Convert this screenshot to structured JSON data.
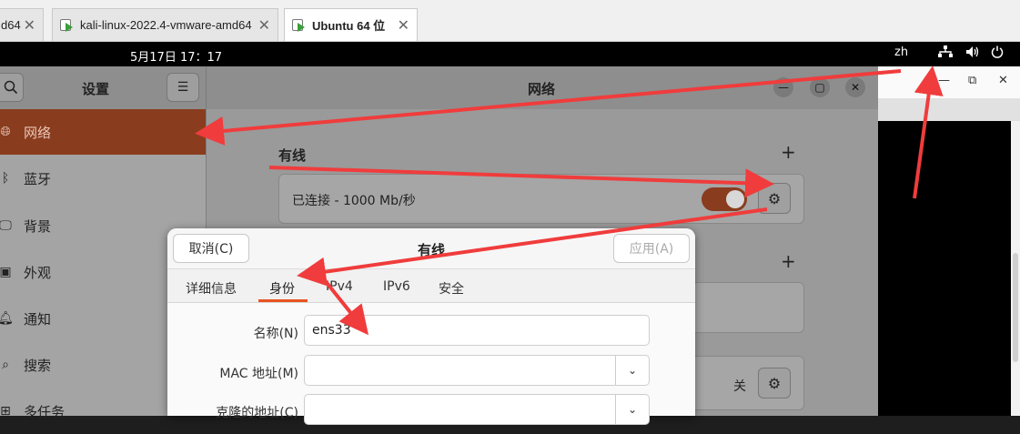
{
  "vmware_tabs": [
    {
      "label": "d64",
      "active": false
    },
    {
      "label": "kali-linux-2022.4-vmware-amd64",
      "active": false
    },
    {
      "label": "Ubuntu 64 位",
      "active": true
    }
  ],
  "topbar": {
    "clock": "5月17日  17：17",
    "lang": "zh",
    "icons": [
      "network-icon",
      "volume-icon",
      "power-icon"
    ]
  },
  "settings": {
    "sidebar_title": "设置",
    "main_title": "网络",
    "sidebar_items": [
      {
        "label": "网络",
        "icon": "globe-icon",
        "active": true
      },
      {
        "label": "蓝牙",
        "icon": "bluetooth-icon",
        "active": false
      },
      {
        "label": "背景",
        "icon": "monitor-icon",
        "active": false
      },
      {
        "label": "外观",
        "icon": "appearance-icon",
        "active": false
      },
      {
        "label": "通知",
        "icon": "bell-icon",
        "active": false
      },
      {
        "label": "搜索",
        "icon": "search-icon",
        "active": false
      },
      {
        "label": "多任务",
        "icon": "multitask-icon",
        "active": false
      }
    ],
    "wired_section_label": "有线",
    "wired_status": "已连接 - 1000 Mb/秒",
    "wired_enabled": true,
    "proxy_status": "关"
  },
  "dialog": {
    "title": "有线",
    "cancel_label": "取消(C)",
    "apply_label": "应用(A)",
    "tabs": [
      "详细信息",
      "身份",
      "IPv4",
      "IPv6",
      "安全"
    ],
    "active_tab": "身份",
    "fields": {
      "name_label": "名称(N)",
      "name_value": "ens33",
      "mac_label": "MAC 地址(M)",
      "mac_value": "",
      "clone_label": "克隆的地址(C)",
      "clone_value": ""
    }
  },
  "colors": {
    "accent": "#e95420",
    "selected_sidebar": "#8a3c1e",
    "annotation_arrow": "#f03c3c"
  }
}
